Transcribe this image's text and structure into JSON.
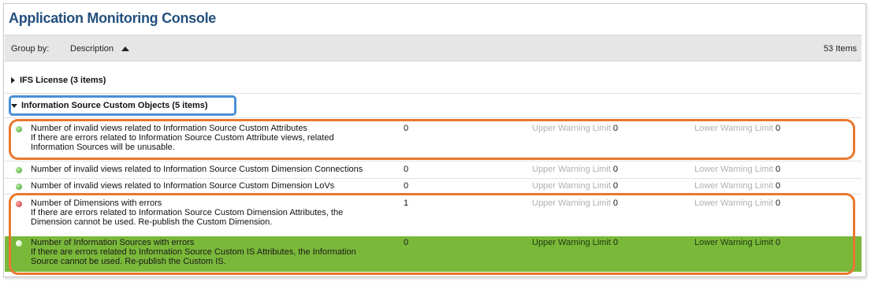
{
  "app": {
    "title": "Application Monitoring Console"
  },
  "toolbar": {
    "group_by_label": "Group by:",
    "group_by_value": "Description",
    "items_count": "53 Items"
  },
  "groups": [
    {
      "label": "IFS License (3 items)",
      "expanded": false
    },
    {
      "label": "Information Source Custom Objects (5 items)",
      "expanded": true
    }
  ],
  "rows": [
    {
      "status": "ok",
      "title": "Number of invalid views related to Information Source Custom Attributes",
      "detail": [
        "If there are errors related to Information Source Custom Attribute views, related",
        "Information Sources will be unusable."
      ],
      "value": "0",
      "upper_label": "Upper Warning Limit",
      "upper_value": "0",
      "lower_label": "Lower Warning Limit",
      "lower_value": "0"
    },
    {
      "status": "ok",
      "title": "Number of invalid views related to Information Source Custom Dimension Connections",
      "detail": [],
      "value": "0",
      "upper_label": "Upper Warning Limit",
      "upper_value": "0",
      "lower_label": "Lower Warning Limit",
      "lower_value": "0"
    },
    {
      "status": "ok",
      "title": "Number of invalid views related to Information Source Custom Dimension LoVs",
      "detail": [],
      "value": "0",
      "upper_label": "Upper Warning Limit",
      "upper_value": "0",
      "lower_label": "Lower Warning Limit",
      "lower_value": "0"
    },
    {
      "status": "error",
      "title": "Number of Dimensions with errors",
      "detail": [
        "If there are errors related to Information Source Custom Dimension Attributes, the",
        "Dimension cannot be used. Re-publish the Custom Dimension."
      ],
      "value": "1",
      "upper_label": "Upper Warning Limit",
      "upper_value": "0",
      "lower_label": "Lower Warning Limit",
      "lower_value": "0"
    },
    {
      "status": "ok",
      "title": "Number of Information Sources with errors",
      "detail": [
        "If there are errors related to Information Source Custom IS Attributes, the Information",
        "Source cannot be used. Re-publish the Custom IS."
      ],
      "value": "0",
      "upper_label": "Upper Warning Limit",
      "upper_value": "0",
      "lower_label": "Lower Warning Limit",
      "lower_value": "0",
      "selected": true
    }
  ],
  "colors": {
    "title": "#24507e",
    "selected_row": "#7ab83a",
    "callout_blue": "#4a8fd6",
    "callout_orange": "#e8782e"
  }
}
